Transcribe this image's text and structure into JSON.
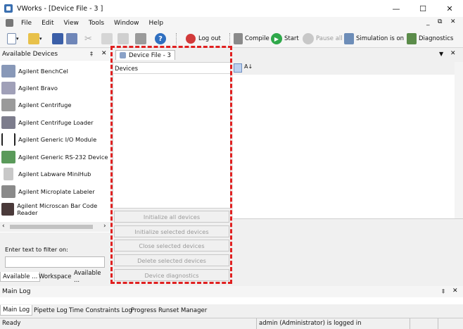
{
  "window": {
    "title": "VWorks - [Device File - 3  ]"
  },
  "menu": {
    "items": [
      "File",
      "Edit",
      "View",
      "Tools",
      "Window",
      "Help"
    ]
  },
  "toolbar": {
    "logout": "Log out",
    "compile": "Compile",
    "start": "Start",
    "pause_all": "Pause all",
    "simulation": "Simulation is on",
    "diagnostics": "Diagnostics"
  },
  "available_devices": {
    "header": "Available Devices",
    "items": [
      "Agilent BenchCel",
      "Agilent Bravo",
      "Agilent Centrifuge",
      "Agilent Centrifuge Loader",
      "Agilent Generic I/O Module",
      "Agilent Generic RS-232 Device",
      "Agilent Labware MiniHub",
      "Agilent Microplate Labeler",
      "Agilent Microscan Bar Code Reader"
    ],
    "filter_label": "Enter text to filter on:",
    "filter_value": "",
    "tabs": [
      "Available ...",
      "Workspace",
      "Available ..."
    ]
  },
  "device_file": {
    "tab": "Device File - 3",
    "devices_header": "Devices",
    "buttons": [
      "Initialize all devices",
      "Initialize selected devices",
      "Close selected devices",
      "Delete selected devices",
      "Device diagnostics"
    ]
  },
  "main_log": {
    "header": "Main Log",
    "tabs": [
      "Main Log",
      "Pipette Log",
      "Time Constraints Log",
      "Progress",
      "Runset Manager"
    ]
  },
  "status": {
    "left": "Ready",
    "right": "admin (Administrator) is logged in"
  },
  "colors": {
    "highlight_border": "#e02020",
    "accent": "#2f6fc0"
  }
}
